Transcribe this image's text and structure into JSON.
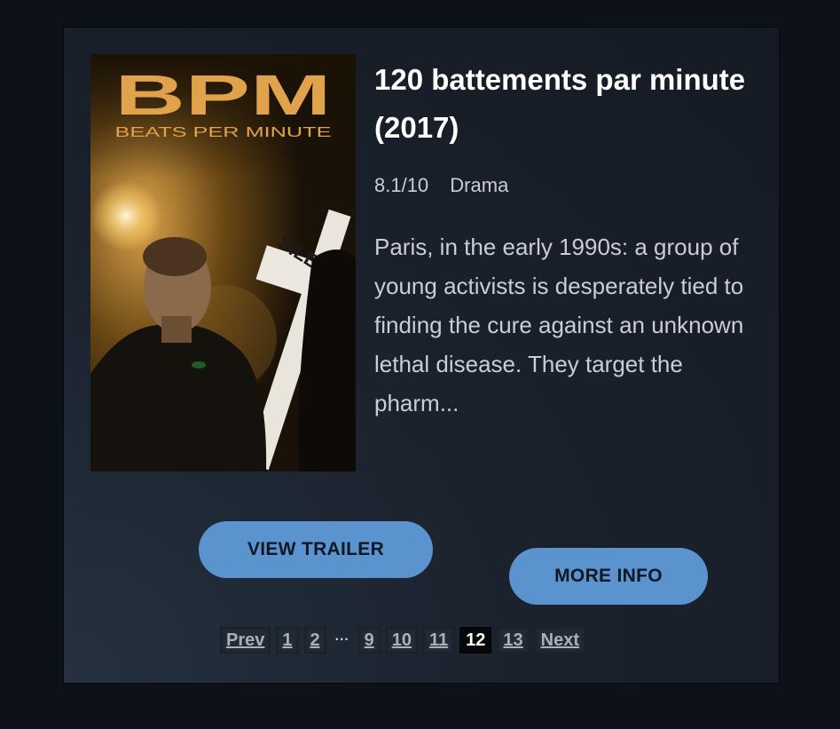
{
  "movie": {
    "title": "120 battements par minute (2017)",
    "rating": "8.1/10",
    "genre": "Drama",
    "description": "Paris, in the early 1990s: a group of young activists is desperately tied to finding the cure against an unknown lethal disease. They target the pharm..."
  },
  "poster": {
    "logo": "BPM",
    "tagline": "BEATS PER MINUTE",
    "sign_text": "SILENCE=M"
  },
  "actions": {
    "trailer_label": "VIEW TRAILER",
    "more_info_label": "MORE INFO"
  },
  "pagination": {
    "prev_label": "Prev",
    "next_label": "Next",
    "ellipsis": "···",
    "pages_before": [
      "1",
      "2"
    ],
    "pages_after": [
      "9",
      "10",
      "11"
    ],
    "current": "12",
    "pages_trailing": [
      "13"
    ]
  },
  "colors": {
    "button": "#5b93cf",
    "background": "#0d1118",
    "card": "#1a222d"
  }
}
